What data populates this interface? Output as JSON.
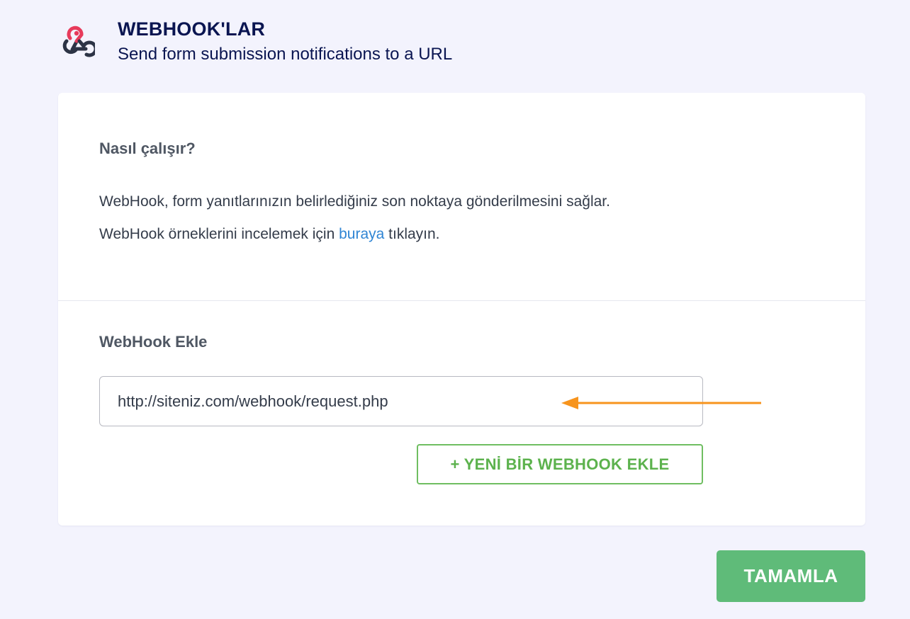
{
  "header": {
    "icon": "webhook-icon",
    "title": "WEBHOOK'LAR",
    "subtitle": "Send form submission notifications to a URL"
  },
  "how_it_works": {
    "title": "Nasıl çalışır?",
    "line1": "WebHook, form yanıtlarınızın belirlediğiniz son noktaya gönderilmesini sağlar.",
    "line2_prefix": "WebHook örneklerini incelemek için ",
    "line2_link": "buraya",
    "line2_suffix": " tıklayın."
  },
  "add_webhook": {
    "title": "WebHook Ekle",
    "url_value": "http://siteniz.com/webhook/request.php",
    "add_button_label": "+ YENİ BİR WEBHOOK EKLE"
  },
  "footer": {
    "complete_button_label": "TAMAMLA"
  },
  "colors": {
    "page_background": "#f3f3fd",
    "title_navy": "#0a1551",
    "link_blue": "#2f85d4",
    "green_outline": "#6fbe61",
    "complete_green": "#5fbb79",
    "annotation_arrow": "#f7941d",
    "logo_red": "#e73a5b",
    "logo_dark": "#2c3345"
  }
}
